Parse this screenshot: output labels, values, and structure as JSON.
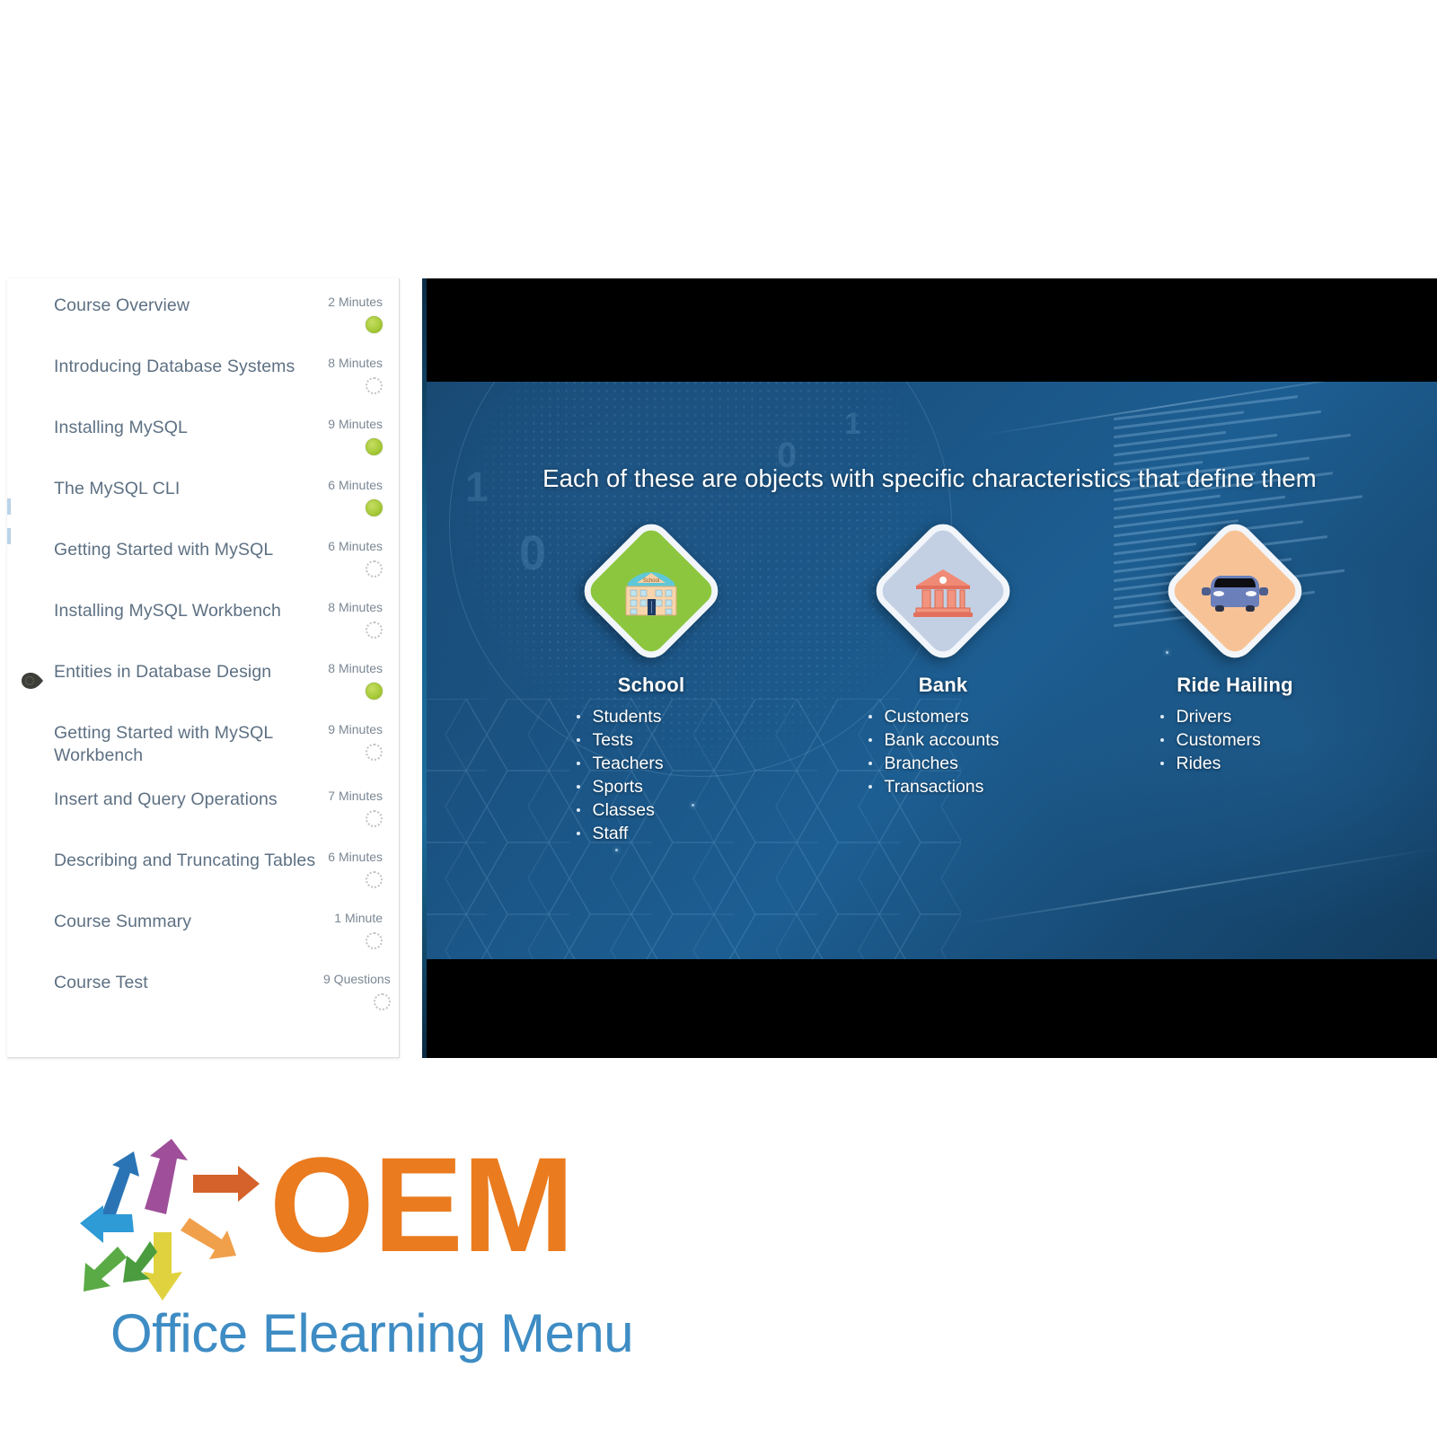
{
  "sidebar": {
    "name": "course-table-of-contents",
    "items": [
      {
        "label": "Course Overview",
        "duration": "2 Minutes",
        "status": "done",
        "active": false
      },
      {
        "label": "Introducing Database Systems",
        "duration": "8 Minutes",
        "status": "todo",
        "active": false
      },
      {
        "label": "Installing MySQL",
        "duration": "9 Minutes",
        "status": "done",
        "active": false
      },
      {
        "label": "The MySQL CLI",
        "duration": "6 Minutes",
        "status": "done",
        "active": false
      },
      {
        "label": "Getting Started with MySQL",
        "duration": "6 Minutes",
        "status": "todo",
        "active": false
      },
      {
        "label": "Installing MySQL Workbench",
        "duration": "8 Minutes",
        "status": "todo",
        "active": false
      },
      {
        "label": "Entities in Database Design",
        "duration": "8 Minutes",
        "status": "done",
        "active": true
      },
      {
        "label": "Getting Started with MySQL Workbench",
        "duration": "9 Minutes",
        "status": "todo",
        "active": false
      },
      {
        "label": "Insert and Query Operations",
        "duration": "7 Minutes",
        "status": "todo",
        "active": false
      },
      {
        "label": "Describing and Truncating Tables",
        "duration": "6 Minutes",
        "status": "todo",
        "active": false
      },
      {
        "label": "Course Summary",
        "duration": "1 Minute",
        "status": "todo",
        "active": false
      },
      {
        "label": "Course Test",
        "duration": "9 Questions",
        "status": "todo",
        "active": false
      }
    ]
  },
  "slide": {
    "headline": "Each of these are objects with specific characteristics that define them",
    "cards": [
      {
        "title": "School",
        "icon": "school-building-icon",
        "diamond_color": "#8cc63f",
        "bullets": [
          "Students",
          "Tests",
          "Teachers",
          "Sports",
          "Classes",
          "Staff"
        ]
      },
      {
        "title": "Bank",
        "icon": "bank-building-icon",
        "diamond_color": "#c3d0e4",
        "bullets": [
          "Customers",
          "Bank accounts",
          "Branches",
          "Transactions"
        ]
      },
      {
        "title": "Ride Hailing",
        "icon": "car-icon",
        "diamond_color": "#f7c396",
        "bullets": [
          "Drivers",
          "Customers",
          "Rides"
        ]
      }
    ]
  },
  "logo": {
    "wordmark": "OEM",
    "tagline": "Office Elearning Menu",
    "wordmark_color": "#ea7b1f",
    "tagline_color": "#3e8cc4",
    "arrow_colors": [
      "#2a74b5",
      "#a0519a",
      "#d4622a",
      "#2e9ad6",
      "#eda martial",
      "#4a9c3f",
      "#e0d23f",
      "#f0a04b"
    ]
  },
  "colors": {
    "status_done": "#a8cb3a",
    "status_todo": "#c2c2c2",
    "sidebar_link": "#5d7083",
    "duration_text": "#7b8794",
    "slide_background": "#1a5383"
  }
}
